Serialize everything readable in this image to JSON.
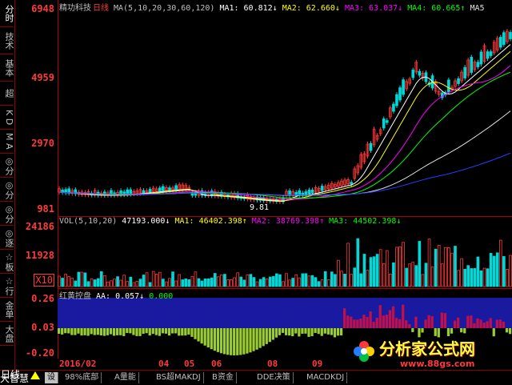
{
  "sidebar": [
    "分时",
    "技术",
    "基本",
    "超",
    "K D",
    "M A",
    "◎分",
    "◎分",
    "◎分",
    "◎逐",
    "☆板",
    "☆行",
    "金单",
    "大盘"
  ],
  "price_axis": {
    "labels": [
      "6948",
      "4959",
      "2970",
      "981"
    ],
    "colors": {
      "up": "#ff3a3a",
      "down": "#00d8d8",
      "ma1": "#ffffff",
      "ma2": "#ffff00",
      "ma3": "#ff00ff",
      "ma4": "#00ff00",
      "ma5": "#e0e0e0",
      "ma6": "#2040ff"
    }
  },
  "main_header": {
    "name": "精功科技",
    "period": "日线",
    "ma_params": "MA(5,10,20,30,60,120)",
    "ma1": "MA1: 60.812↓",
    "ma2": "MA2: 62.660↓",
    "ma3": "MA3: 63.037↓",
    "ma4": "MA4: 60.665↑",
    "ma5": "MA5"
  },
  "low_mark": "9.81",
  "vol_axis": {
    "labels": [
      "24186",
      "11928"
    ],
    "unit": "X10"
  },
  "vol_header": {
    "params": "VOL(5,10,20)",
    "vol": "47193.000↓",
    "ma1": "MA1: 46402.398↑",
    "ma2": "MA2: 38769.398↑",
    "ma3": "MA3: 44502.398↓"
  },
  "ind_axis": {
    "labels": [
      "0.26",
      "0.03",
      "-0.20"
    ]
  },
  "ind_header": {
    "name": "红黄控盘",
    "aa": "AA: 0.057↓",
    "zero": "0.000"
  },
  "date_axis": {
    "start": "2016/02",
    "labels": [
      "04",
      "05",
      "06",
      "08",
      "09"
    ]
  },
  "tabs": [
    "日线",
    "大智慧",
    "设",
    "98%底部",
    "A量能",
    "BS超MAKDJ",
    "B资金",
    "DDE决策",
    "MACDKDJ"
  ],
  "watermark": {
    "title": "分析家公式网",
    "url": "www.88gs.com"
  }
}
